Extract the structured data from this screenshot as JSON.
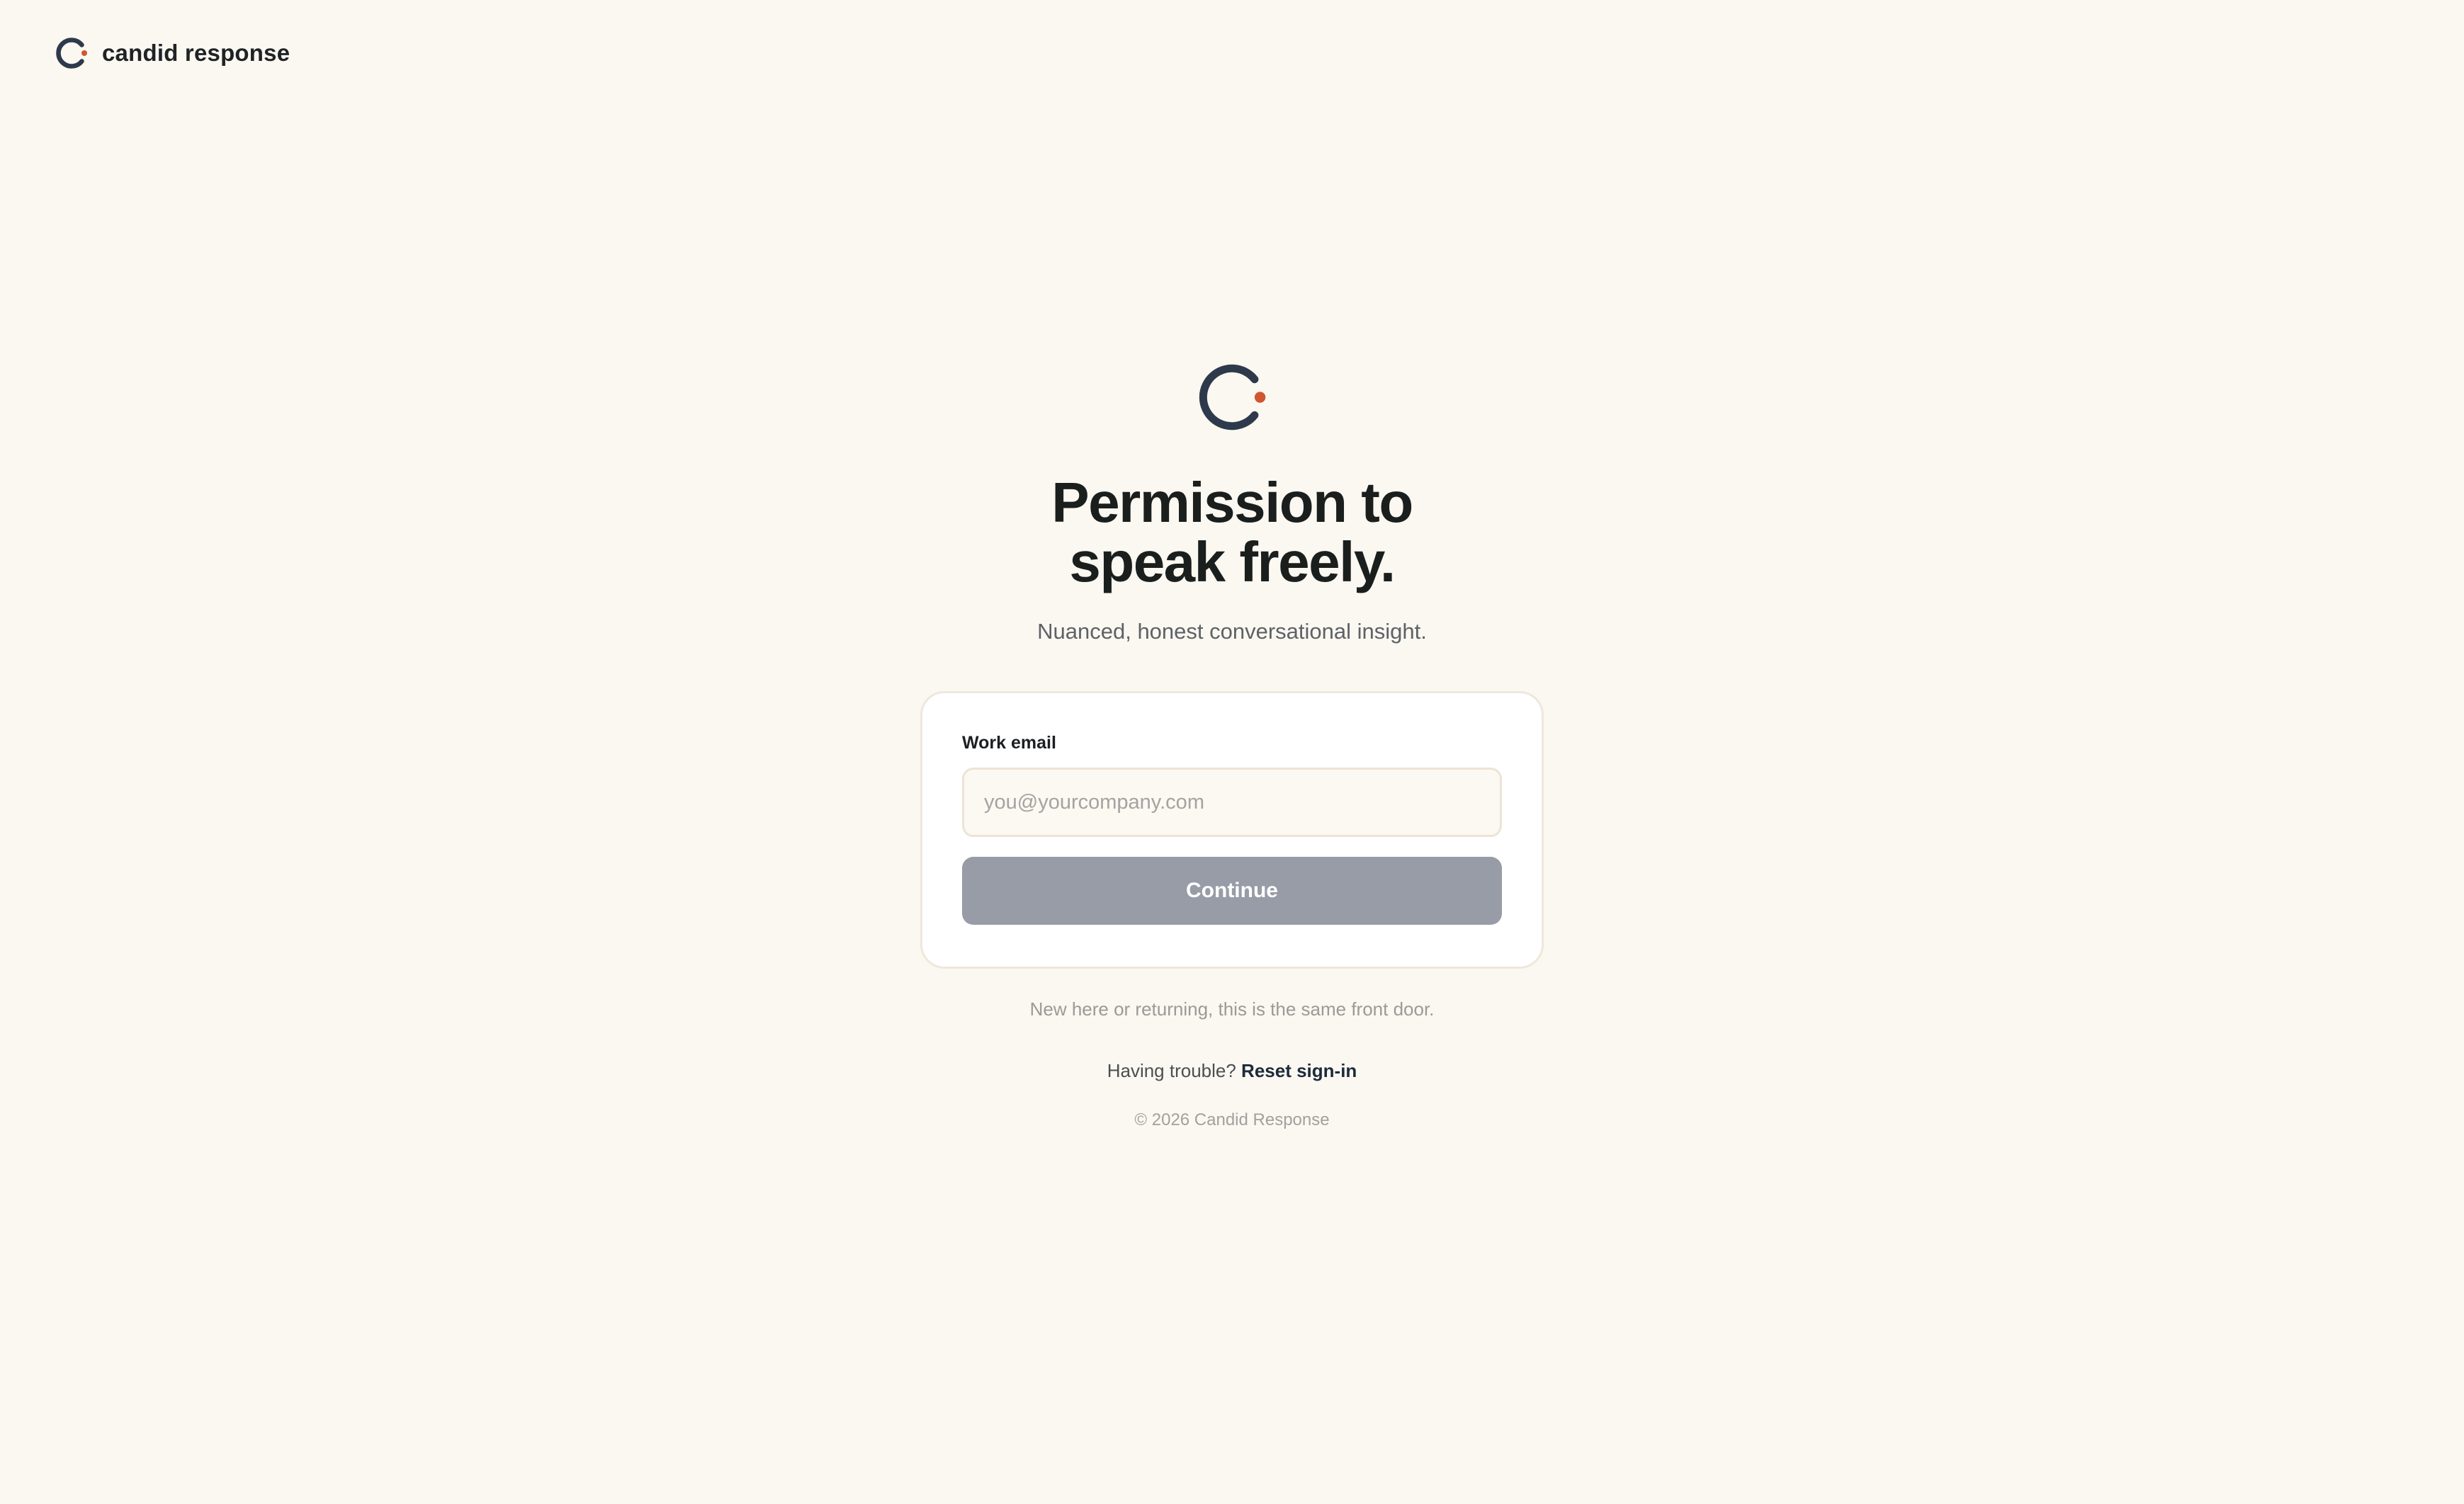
{
  "brand": {
    "name": "candid response",
    "logo_icon": "candid-c-logo-icon",
    "colors": {
      "ring": "#2e3a4b",
      "dot": "#d2552f"
    }
  },
  "hero": {
    "headline_line1": "Permission to",
    "headline_line2": "speak freely.",
    "subtitle": "Nuanced, honest conversational insight."
  },
  "form": {
    "email_label": "Work email",
    "email_placeholder": "you@yourcompany.com",
    "email_value": "",
    "continue_label": "Continue",
    "continue_button_color": "#979ca6"
  },
  "footer": {
    "helper_note": "New here or returning, this is the same front door.",
    "trouble_text": "Having trouble?",
    "reset_link_label": "Reset sign-in",
    "copyright": "© 2026 Candid Response"
  },
  "theme": {
    "background": "#fbf7f1",
    "card_background": "#ffffff"
  }
}
